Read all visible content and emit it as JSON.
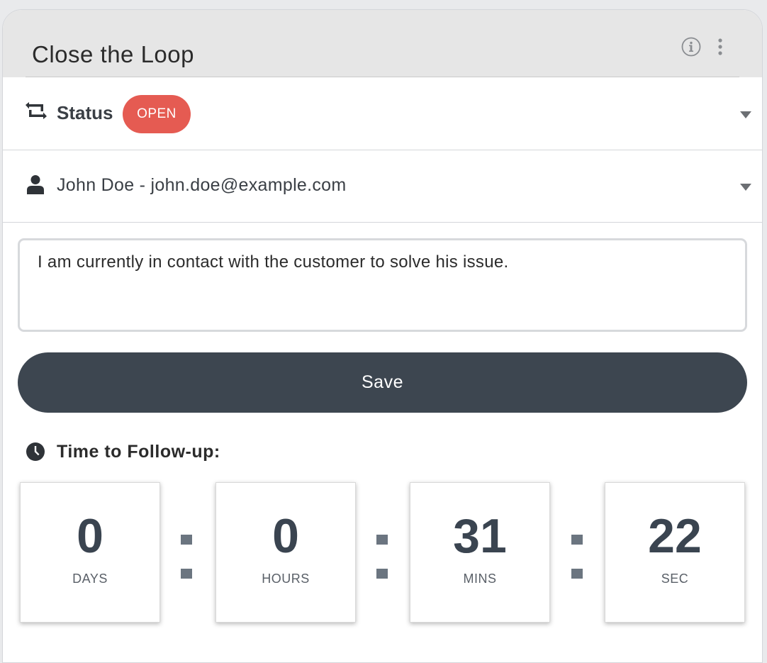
{
  "card": {
    "title": "Close the Loop",
    "header_icons": [
      "info-icon",
      "more-vertical-icon"
    ]
  },
  "status": {
    "icon": "repeat-arrows-icon",
    "label": "Status",
    "badge": "OPEN",
    "badge_color": "#e55b52"
  },
  "assignee": {
    "icon": "user-icon",
    "label": "John Doe - john.doe@example.com"
  },
  "note": {
    "value": "I am currently in contact with the customer to solve his issue."
  },
  "save": {
    "label": "Save",
    "color": "#3d4650"
  },
  "followup": {
    "icon": "clock-icon",
    "label": "Time to Follow-up:",
    "countdown": [
      {
        "value": "0",
        "unit": "DAYS"
      },
      {
        "value": "0",
        "unit": "HOURS"
      },
      {
        "value": "31",
        "unit": "MINS"
      },
      {
        "value": "22",
        "unit": "SEC"
      }
    ]
  }
}
